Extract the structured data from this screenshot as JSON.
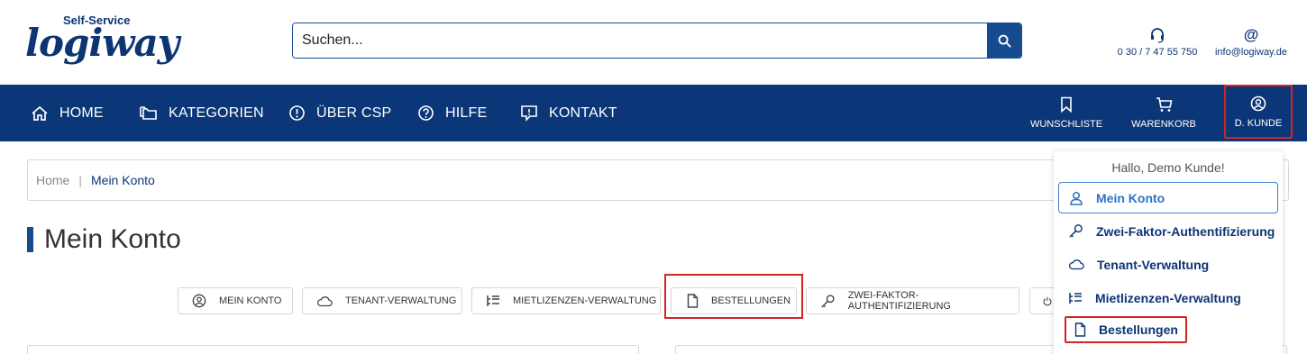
{
  "header": {
    "logo_top": "Self-Service",
    "logo_main": "logiway",
    "search_placeholder": "Suchen...",
    "phone": "0 30 / 7 47 55 750",
    "email": "info@logiway.de"
  },
  "nav": {
    "items": [
      {
        "label": "HOME",
        "icon": "home-icon"
      },
      {
        "label": "KATEGORIEN",
        "icon": "folders-icon"
      },
      {
        "label": "ÜBER CSP",
        "icon": "info-icon"
      },
      {
        "label": "HILFE",
        "icon": "question-icon"
      },
      {
        "label": "KONTAKT",
        "icon": "message-icon"
      }
    ],
    "right": [
      {
        "label": "WUNSCHLISTE",
        "icon": "bookmark-icon"
      },
      {
        "label": "WARENKORB",
        "icon": "cart-icon"
      },
      {
        "label": "D. KUNDE",
        "icon": "user-circle-icon"
      }
    ]
  },
  "breadcrumb": {
    "home": "Home",
    "separator": "|",
    "current": "Mein Konto"
  },
  "page": {
    "title": "Mein Konto"
  },
  "tabs": [
    {
      "label": "MEIN KONTO",
      "icon": "user-circle-icon"
    },
    {
      "label": "TENANT-VERWALTUNG",
      "icon": "cloud-icon"
    },
    {
      "label": "MIETLIZENZEN-VERWALTUNG",
      "icon": "list-tree-icon"
    },
    {
      "label": "BESTELLUNGEN",
      "icon": "file-icon"
    },
    {
      "label": "ZWEI-FAKTOR-AUTHENTIFIZIERUNG",
      "icon": "key-icon"
    }
  ],
  "dropdown": {
    "greeting": "Hallo, Demo Kunde!",
    "items": [
      {
        "label": "Mein Konto",
        "icon": "user-icon"
      },
      {
        "label": "Zwei-Faktor-Authentifizierung",
        "icon": "key-icon"
      },
      {
        "label": "Tenant-Verwaltung",
        "icon": "cloud-icon"
      },
      {
        "label": "Mietlizenzen-Verwaltung",
        "icon": "list-tree-icon"
      },
      {
        "label": "Bestellungen",
        "icon": "file-icon"
      }
    ]
  },
  "colors": {
    "nav_bg": "#0b3677",
    "brand": "#174b8f",
    "highlight_red": "#d42426",
    "active_blue": "#2c73c9"
  }
}
